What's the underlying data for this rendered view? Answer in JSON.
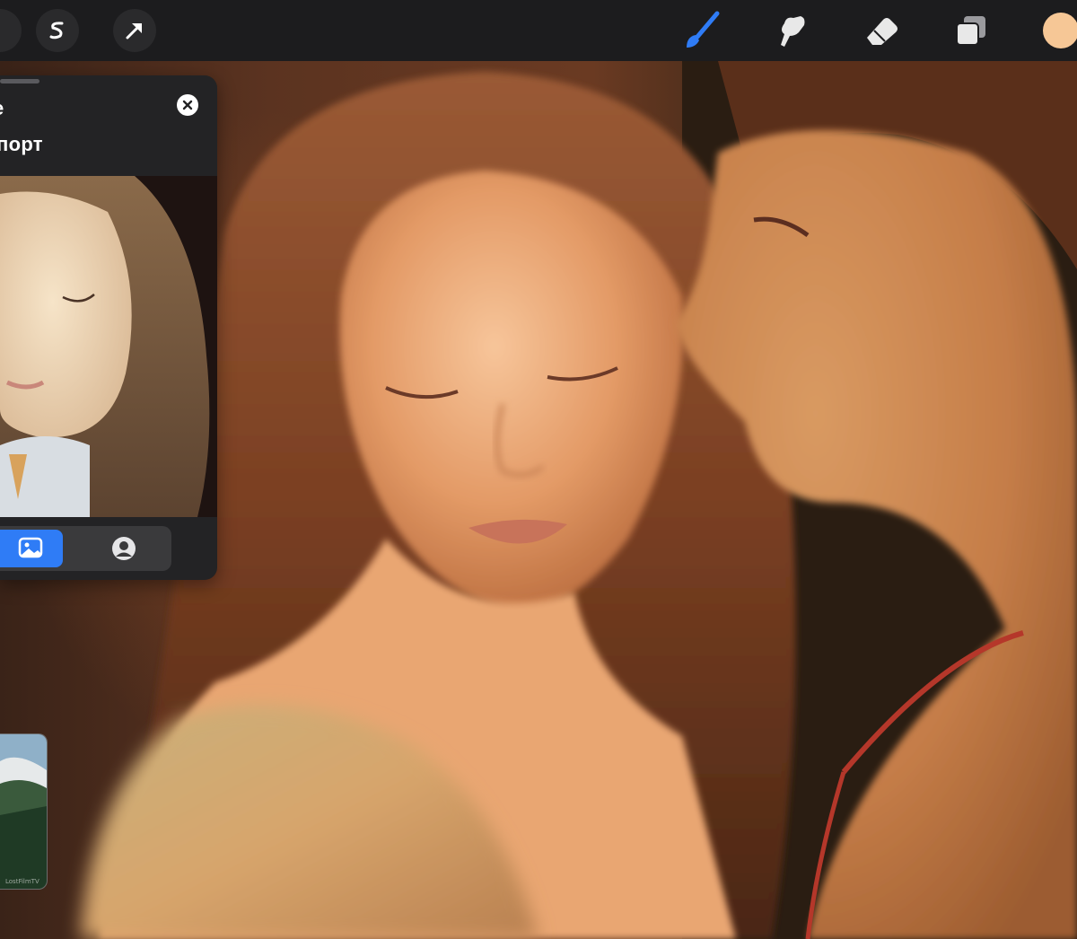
{
  "panel": {
    "title_fragment": "e",
    "subtitle_fragment": "порт",
    "close_icon": "close-icon",
    "tabs": [
      {
        "icon": "image-icon",
        "selected": true
      },
      {
        "icon": "face-icon",
        "selected": false
      }
    ]
  },
  "thumbnail": {
    "caption": "LostFilmTV"
  },
  "toolbar": {
    "tools": [
      "adjustments-icon",
      "selection-icon",
      "transform-arrow-icon",
      "brush-icon",
      "smudge-icon",
      "eraser-icon",
      "layers-icon"
    ],
    "active_tool": "brush-icon",
    "current_color": "#f6c796",
    "accent_color": "#2f7cf6"
  }
}
